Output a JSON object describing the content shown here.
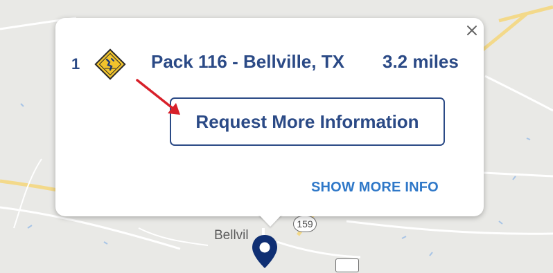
{
  "map": {
    "town_label": "Bellvil",
    "highway_shield": "159"
  },
  "popup": {
    "result_number": "1",
    "pack_name": "Pack 116 - Bellville, TX",
    "distance": "3.2 miles",
    "request_button_label": "Request More Information",
    "show_more_label": "SHOW MORE INFO",
    "close_label": "×"
  },
  "colors": {
    "brand_navy": "#2b4a86",
    "link_blue": "#2f78c8",
    "badge_yellow": "#f2c42c",
    "arrow_red": "#d8202a",
    "pin_navy": "#0f2f73"
  }
}
